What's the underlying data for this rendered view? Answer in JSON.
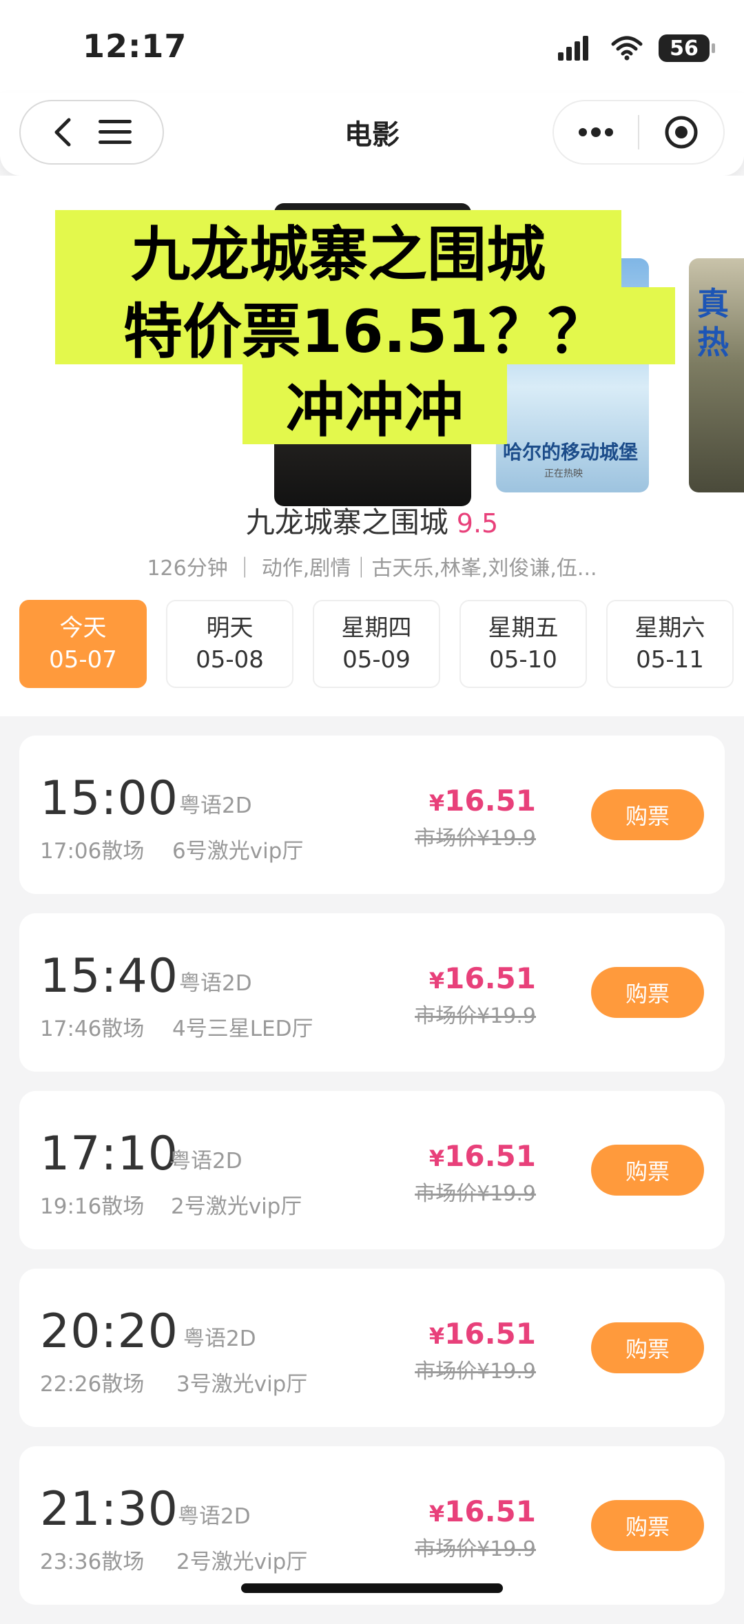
{
  "status_bar": {
    "time": "12:17",
    "battery": "56"
  },
  "nav": {
    "title": "电影"
  },
  "hero": {
    "overlay_lines": [
      "九龙城寨之围城",
      "特价票16.51？？",
      "冲冲冲"
    ],
    "poster2_text": "哈尔的移动城堡",
    "poster2_sub": "正在热映",
    "poster3_text": "真\n热"
  },
  "movie": {
    "title": "九龙城寨之围城",
    "score": "9.5",
    "meta": "126分钟 ｜ 动作,剧情｜古天乐,林峯,刘俊谦,伍..."
  },
  "dates": [
    {
      "day": "今天",
      "date": "05-07",
      "active": true
    },
    {
      "day": "明天",
      "date": "05-08",
      "active": false
    },
    {
      "day": "星期四",
      "date": "05-09",
      "active": false
    },
    {
      "day": "星期五",
      "date": "05-10",
      "active": false
    },
    {
      "day": "星期六",
      "date": "05-11",
      "active": false
    }
  ],
  "showtimes": [
    {
      "time": "15:00",
      "lang": "粤语2D",
      "end": "17:06散场",
      "hall": "6号激光vip厅",
      "price": "16.51",
      "market": "市场价¥19.9",
      "button": "购票"
    },
    {
      "time": "15:40",
      "lang": "粤语2D",
      "end": "17:46散场",
      "hall": "4号三星LED厅",
      "price": "16.51",
      "market": "市场价¥19.9",
      "button": "购票"
    },
    {
      "time": "17:10",
      "lang": "粤语2D",
      "end": "19:16散场",
      "hall": "2号激光vip厅",
      "price": "16.51",
      "market": "市场价¥19.9",
      "button": "购票"
    },
    {
      "time": "20:20",
      "lang": "粤语2D",
      "end": "22:26散场",
      "hall": "3号激光vip厅",
      "price": "16.51",
      "market": "市场价¥19.9",
      "button": "购票"
    },
    {
      "time": "21:30",
      "lang": "粤语2D",
      "end": "23:36散场",
      "hall": "2号激光vip厅",
      "price": "16.51",
      "market": "市场价¥19.9",
      "button": "购票"
    }
  ],
  "currency_symbol": "¥",
  "colors": {
    "accent": "#ff9a3c",
    "price": "#e8407a",
    "highlight": "#e3f84c"
  }
}
